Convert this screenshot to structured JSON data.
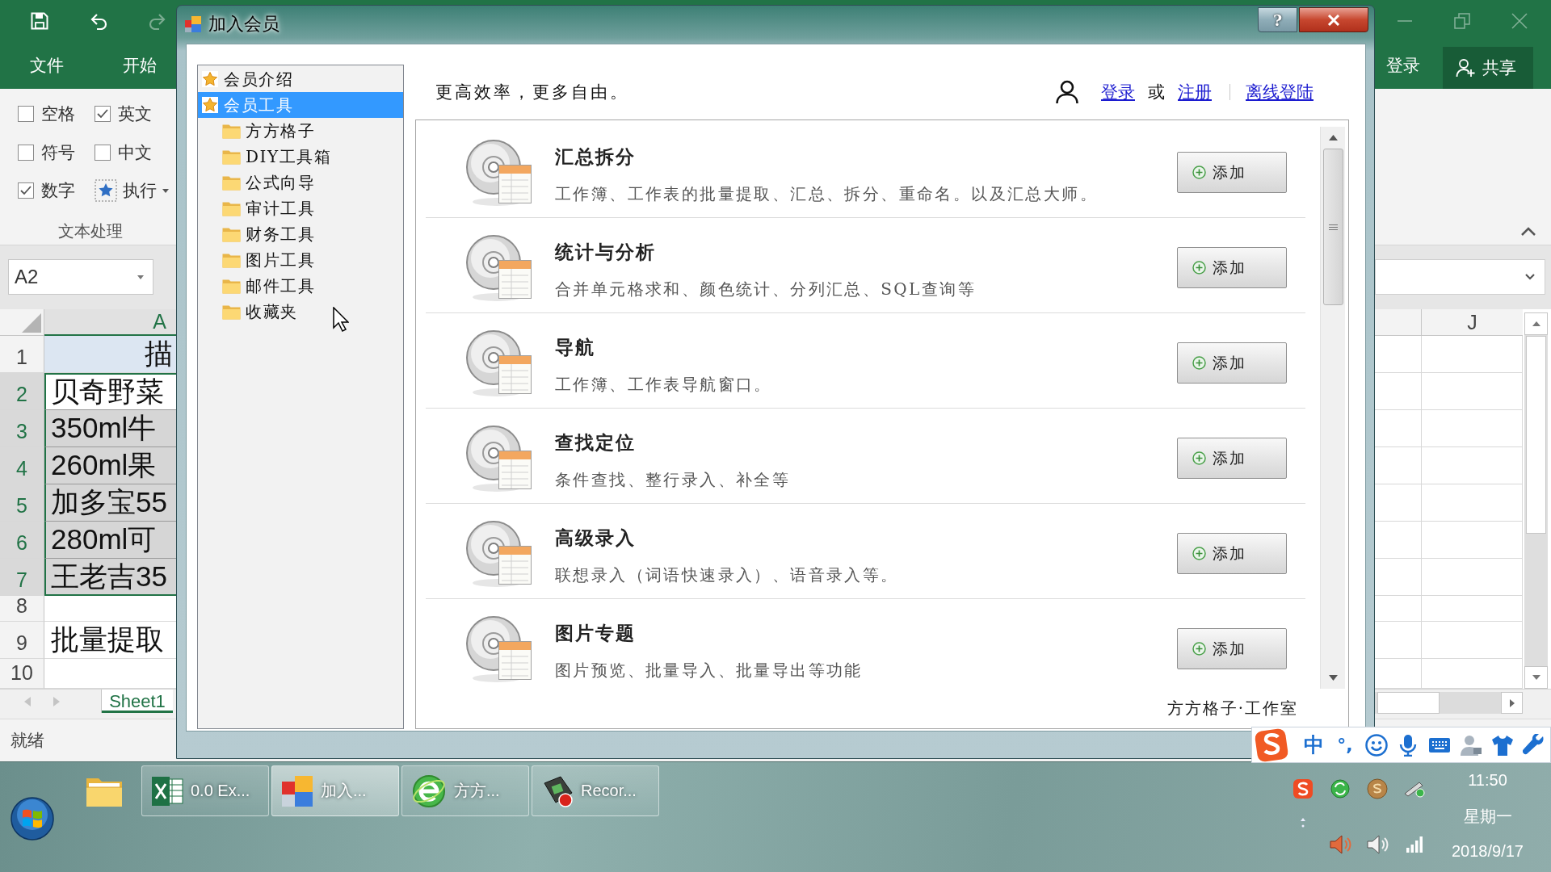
{
  "excel": {
    "quick_access": [
      {
        "kind": "save",
        "disabled": false
      },
      {
        "kind": "undo",
        "disabled": false
      },
      {
        "kind": "redo",
        "disabled": true
      }
    ],
    "tabs": [
      {
        "label": "文件"
      },
      {
        "label": "开始"
      }
    ],
    "sign_in": "登录",
    "share_button": "共享",
    "options": [
      {
        "kind": "checkbox",
        "label": "空格",
        "checked": false
      },
      {
        "kind": "checkbox",
        "label": "英文",
        "checked": true
      },
      {
        "kind": "checkbox",
        "label": "符号",
        "checked": false
      },
      {
        "kind": "checkbox",
        "label": "中文",
        "checked": false
      },
      {
        "kind": "checkbox",
        "label": "数字",
        "checked": true
      },
      {
        "kind": "button",
        "label": "执行"
      }
    ],
    "group_label": "文本处理",
    "name_box": "A2",
    "columns": [
      {
        "label": "A",
        "selected": true
      },
      {
        "label": "J",
        "selected": false
      }
    ],
    "rows": [
      {
        "number": "1",
        "kind": "header",
        "text": "描",
        "selected": false
      },
      {
        "number": "2",
        "kind": "data",
        "text": "贝奇野菜",
        "selected": true
      },
      {
        "number": "3",
        "kind": "data",
        "text": "350ml牛",
        "selected": true
      },
      {
        "number": "4",
        "kind": "data",
        "text": "260ml果",
        "selected": true
      },
      {
        "number": "5",
        "kind": "data",
        "text": "加多宝55",
        "selected": true
      },
      {
        "number": "6",
        "kind": "data",
        "text": "280ml可",
        "selected": true
      },
      {
        "number": "7",
        "kind": "data",
        "text": "王老吉35",
        "selected": true
      },
      {
        "number": "8",
        "kind": "data",
        "selected": false
      },
      {
        "number": "9",
        "kind": "data",
        "text": "批量提取",
        "selected": false
      },
      {
        "number": "10",
        "kind": "data",
        "selected": false
      }
    ],
    "sheet_tabs": [
      {
        "label": "Sheet1",
        "selected": true
      }
    ],
    "status": "就绪"
  },
  "dialog": {
    "title": "加入会员",
    "help_button": "?",
    "tree": [
      {
        "label": "会员介绍",
        "selected": false
      },
      {
        "label": "会员工具",
        "selected": true,
        "children": [
          {
            "label": "方方格子",
            "selected": false
          },
          {
            "label": "DIY工具箱",
            "selected": false
          },
          {
            "label": "公式向导",
            "selected": false
          },
          {
            "label": "审计工具",
            "selected": false
          },
          {
            "label": "财务工具",
            "selected": false
          },
          {
            "label": "图片工具",
            "selected": false
          },
          {
            "label": "邮件工具",
            "selected": false
          },
          {
            "label": "收藏夹",
            "selected": false
          }
        ]
      }
    ],
    "tagline": "更高效率，更多自由。",
    "account": {
      "sign_in": "登录",
      "or": "或",
      "register": "注册",
      "offline": "离线登陆"
    },
    "tools": [
      {
        "title": "汇总拆分",
        "description": "工作簿、工作表的批量提取、汇总、拆分、重命名。以及汇总大师。",
        "button": "添加"
      },
      {
        "title": "统计与分析",
        "description": "合并单元格求和、颜色统计、分列汇总、SQL查询等",
        "button": "添加"
      },
      {
        "title": "导航",
        "description": "工作簿、工作表导航窗口。",
        "button": "添加"
      },
      {
        "title": "查找定位",
        "description": "条件查找、整行录入、补全等",
        "button": "添加"
      },
      {
        "title": "高级录入",
        "description": "联想录入（词语快速录入）、语音录入等。",
        "button": "添加"
      },
      {
        "title": "图片专题",
        "description": "图片预览、批量导入、批量导出等功能",
        "button": "添加"
      }
    ],
    "footer": "方方格子·工作室"
  },
  "ime": {
    "mode": "中",
    "punctuation": "°,"
  },
  "taskbar": {
    "items": [
      {
        "kind": "spreadsheet",
        "label": "0.0 Ex...",
        "selected": false
      },
      {
        "kind": "app",
        "label": "加入...",
        "selected": true
      },
      {
        "kind": "browser",
        "label": "方方...",
        "selected": false
      },
      {
        "kind": "recorder",
        "label": "Recor...",
        "selected": false
      }
    ],
    "clock": {
      "time": "11:50",
      "weekday": "星期一",
      "date": "2018/9/17"
    }
  }
}
